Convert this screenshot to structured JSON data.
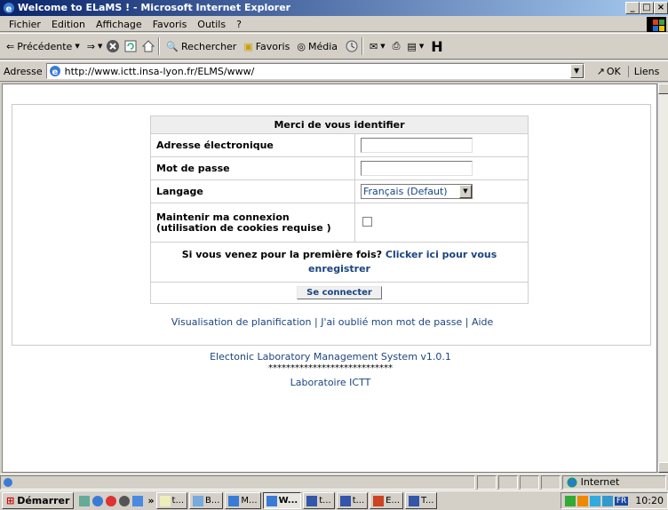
{
  "window": {
    "title": "Welcome to ELaMS ! - Microsoft Internet Explorer",
    "buttons": [
      "_",
      "&#9633;",
      "x"
    ]
  },
  "menu": {
    "items": [
      "Fichier",
      "Edition",
      "Affichage",
      "Favoris",
      "Outils",
      "?"
    ]
  },
  "toolbar": {
    "back_label": "Précédente",
    "search_label": "Rechercher",
    "favorites_label": "Favoris",
    "media_label": "Média"
  },
  "address": {
    "label": "Adresse",
    "url": "http://www.ictt.insa-lyon.fr/ELMS/www/",
    "go_label": "OK",
    "links_label": "Liens"
  },
  "login": {
    "header": "Merci de vous identifier",
    "email_label": "Adresse électronique",
    "password_label": "Mot de passe",
    "language_label": "Langage",
    "language_value": "Français (Defaut)",
    "remember_label": "Maintenir ma connexion (utilisation de cookies requise )",
    "first_time_text": "Si vous venez pour la première fois?",
    "register_link": "Clicker ici pour vous enregistrer",
    "connect_button": "Se connecter"
  },
  "footer_links": {
    "planning": "Visualisation de planification",
    "forgot": "J'ai oublié mon mot de passe",
    "help": "Aide",
    "separator": "|"
  },
  "system": {
    "name": "Electonic Laboratory Management System v1.0.1",
    "stars": "****************************",
    "lab": "Laboratoire ICTT"
  },
  "statusbar": {
    "zone": "Internet"
  },
  "taskbar": {
    "start_label": "Démarrer",
    "tasks": [
      "t...",
      "B...",
      "M...",
      "W...",
      "t...",
      "t...",
      "E...",
      "T..."
    ],
    "clock": "10:20",
    "lang": "FR"
  },
  "colors": {
    "link": "#1a4480",
    "titlebar_start": "#0a246a",
    "titlebar_end": "#a6caf0"
  }
}
